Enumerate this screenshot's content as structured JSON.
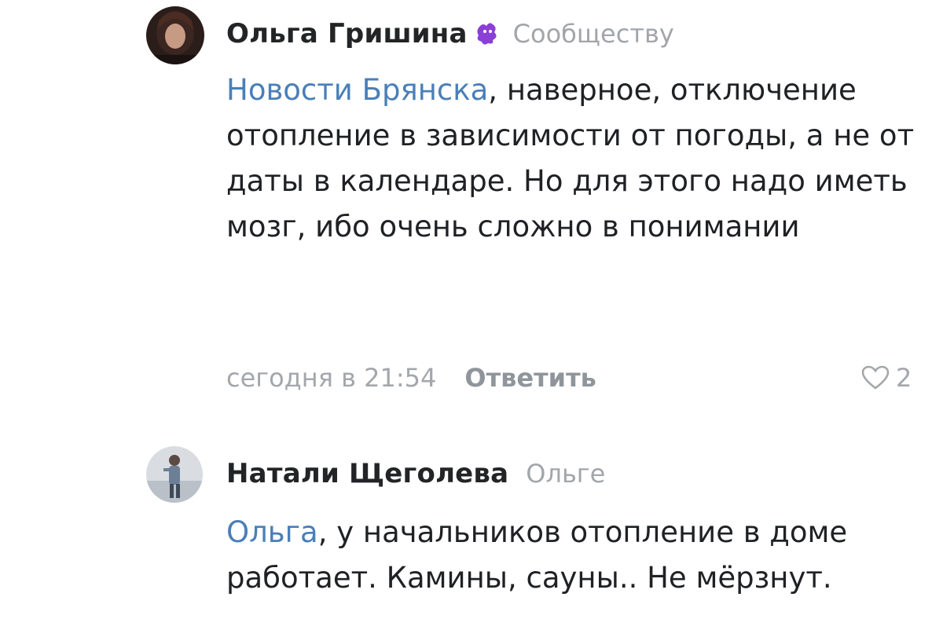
{
  "comments": [
    {
      "author": "Ольга Гришина",
      "badge_icon": "purple-emoji-badge-icon",
      "reply_to": "Сообществу",
      "mention": "Новости Брянска",
      "text": ", наверное, отключение отопление в зависимости от погоды, а не от даты в календаре. Но для этого надо иметь мозг, ибо очень сложно в понимании",
      "time": "сегодня в 21:54",
      "reply_label": "Ответить",
      "likes": "2"
    },
    {
      "author": "Натали Щеголева",
      "reply_to": "Ольге",
      "mention": "Ольга",
      "text": ", у начальников отопление в доме работает. Камины, сауны.. Не мёрзнут."
    }
  ],
  "colors": {
    "mention": "#4a7fb8",
    "muted": "#a3a7ac",
    "text": "#1f2124",
    "badge": "#8b3fd6"
  }
}
